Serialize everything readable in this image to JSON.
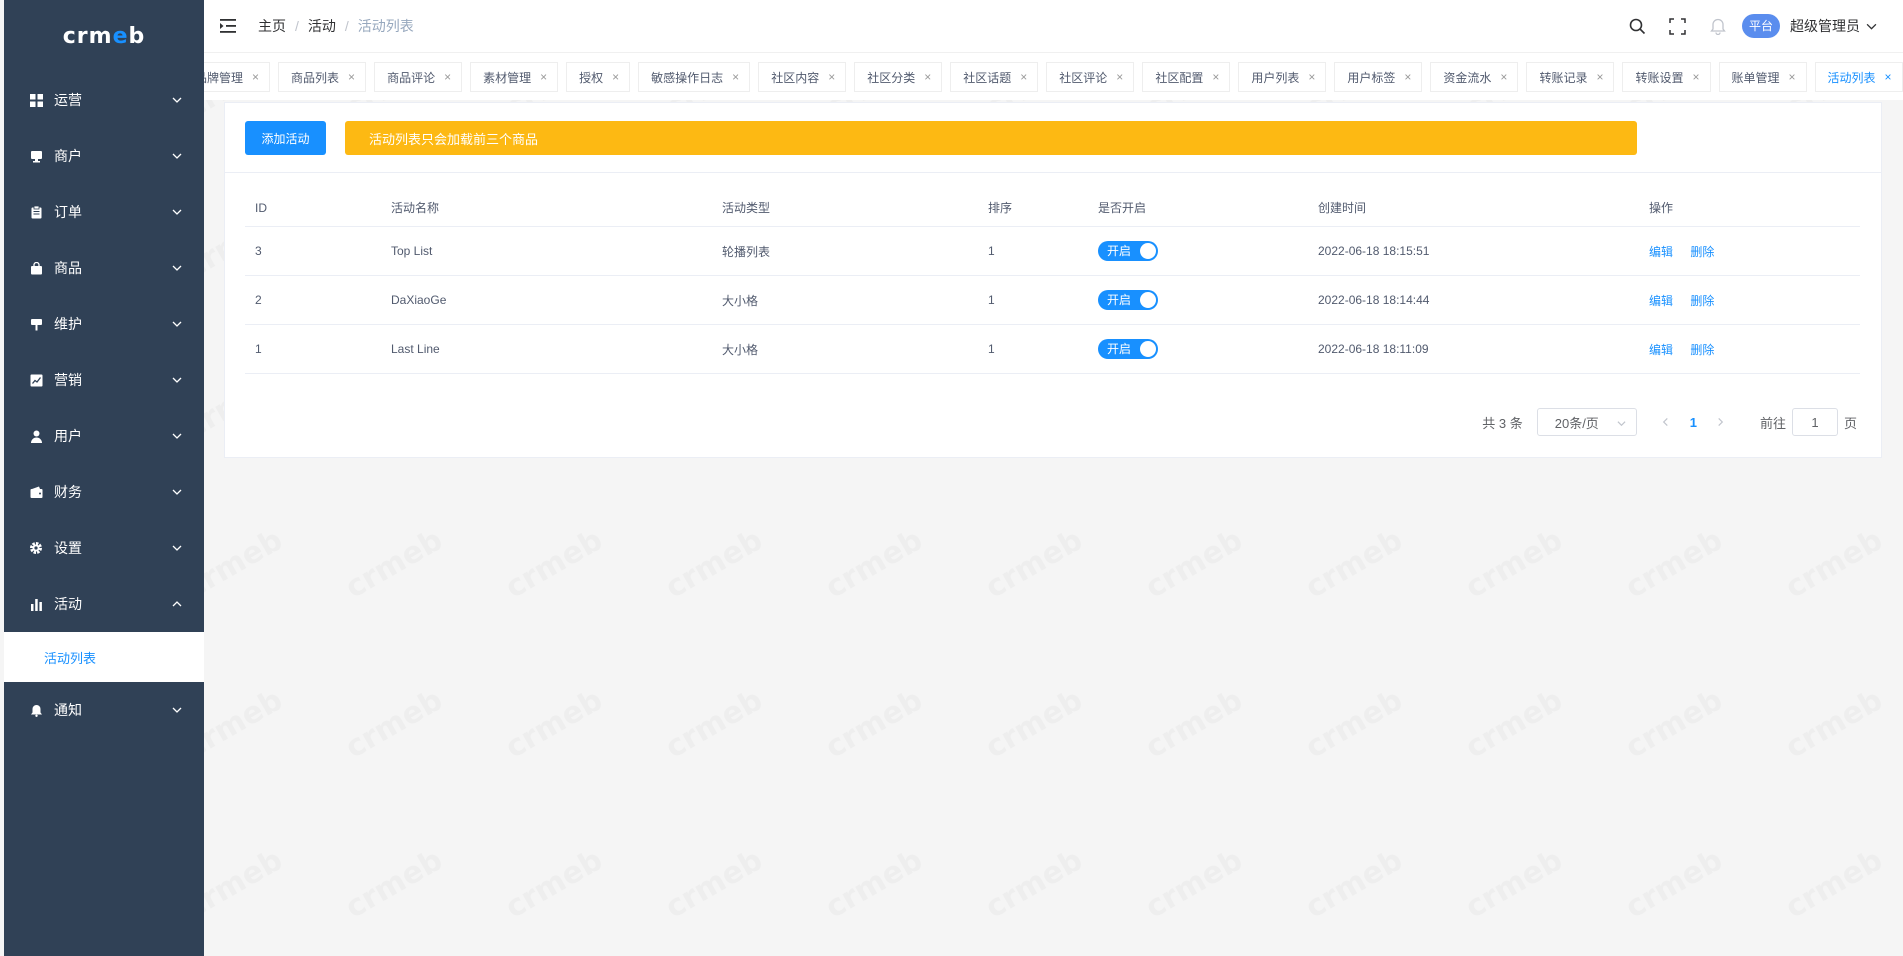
{
  "logo": {
    "text_pre": "crm",
    "text_dot": "e",
    "text_post": "b"
  },
  "sidebar": {
    "items": [
      {
        "label": "运营",
        "icon": "grid-icon"
      },
      {
        "label": "商户",
        "icon": "monitor-icon"
      },
      {
        "label": "订单",
        "icon": "clipboard-icon"
      },
      {
        "label": "商品",
        "icon": "bag-icon"
      },
      {
        "label": "维护",
        "icon": "tool-icon"
      },
      {
        "label": "营销",
        "icon": "trend-icon"
      },
      {
        "label": "用户",
        "icon": "person-icon"
      },
      {
        "label": "财务",
        "icon": "wallet-icon"
      },
      {
        "label": "设置",
        "icon": "gear-icon"
      },
      {
        "label": "活动",
        "icon": "bar-chart-icon",
        "expanded": true
      },
      {
        "label": "通知",
        "icon": "bell-icon"
      }
    ],
    "active_sub": "活动列表"
  },
  "header": {
    "breadcrumb": [
      "主页",
      "活动",
      "活动列表"
    ],
    "badge": "平台",
    "user": "超级管理员"
  },
  "tags": [
    "品牌管理",
    "商品列表",
    "商品评论",
    "素材管理",
    "授权",
    "敏感操作日志",
    "社区内容",
    "社区分类",
    "社区话题",
    "社区评论",
    "社区配置",
    "用户列表",
    "用户标签",
    "资金流水",
    "转账记录",
    "转账设置",
    "账单管理",
    "活动列表"
  ],
  "toolbar": {
    "add_label": "添加活动",
    "notice": "活动列表只会加载前三个商品"
  },
  "table": {
    "headers": [
      "ID",
      "活动名称",
      "活动类型",
      "排序",
      "是否开启",
      "创建时间",
      "操作"
    ],
    "rows": [
      {
        "id": "3",
        "name": "Top List",
        "type": "轮播列表",
        "sort": "1",
        "switch": "开启",
        "created": "2022-06-18 18:15:51"
      },
      {
        "id": "2",
        "name": "DaXiaoGe",
        "type": "大小格",
        "sort": "1",
        "switch": "开启",
        "created": "2022-06-18 18:14:44"
      },
      {
        "id": "1",
        "name": "Last Line",
        "type": "大小格",
        "sort": "1",
        "switch": "开启",
        "created": "2022-06-18 18:11:09"
      }
    ],
    "edit_label": "编辑",
    "delete_label": "删除"
  },
  "pagination": {
    "total": "共 3 条",
    "page_size": "20条/页",
    "current": "1",
    "goto_label": "前往",
    "goto_value": "1",
    "page_suffix": "页"
  },
  "colors": {
    "sidebar": "#304156",
    "primary": "#1890ff",
    "notice": "#fdb913",
    "badge": "#5a8dee"
  }
}
